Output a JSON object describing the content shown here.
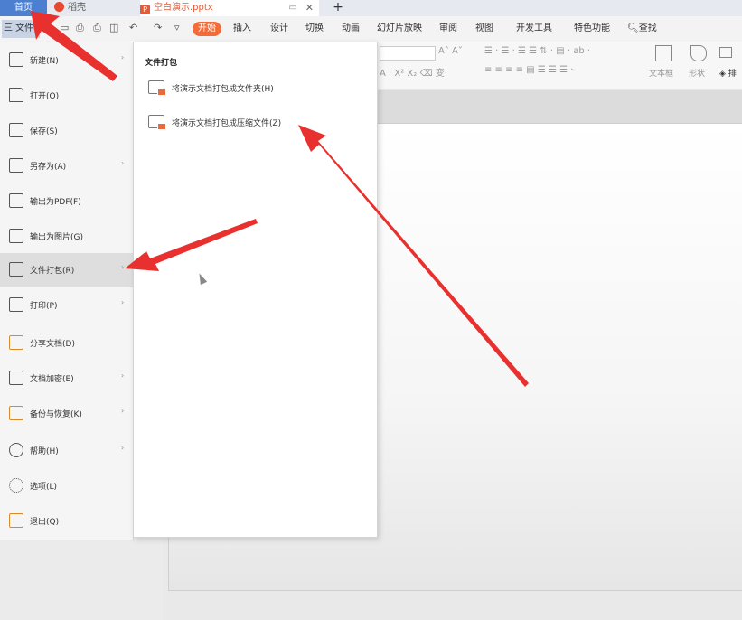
{
  "tabs": {
    "home": "首页",
    "docer": "稻壳",
    "file": "空白演示.pptx"
  },
  "menubar": {
    "file_button": "三 文件",
    "ribbon_tabs": [
      "开始",
      "插入",
      "设计",
      "切换",
      "动画",
      "幻灯片放映",
      "审阅",
      "视图",
      "开发工具",
      "特色功能"
    ],
    "active_tab": "开始",
    "search": "查找"
  },
  "ribbon": {
    "textbox": "文本框",
    "shape": "形状",
    "arrange": "排"
  },
  "file_menu": {
    "items": [
      {
        "label": "新建(N)",
        "icon": "new-file-icon",
        "has_submenu": true
      },
      {
        "label": "打开(O)",
        "icon": "folder-open-icon",
        "has_submenu": false
      },
      {
        "label": "保存(S)",
        "icon": "save-icon",
        "has_submenu": false
      },
      {
        "label": "另存为(A)",
        "icon": "save-as-icon",
        "has_submenu": true
      },
      {
        "label": "输出为PDF(F)",
        "icon": "pdf-export-icon",
        "has_submenu": false
      },
      {
        "label": "输出为图片(G)",
        "icon": "image-export-icon",
        "has_submenu": false
      },
      {
        "label": "文件打包(R)",
        "icon": "package-icon",
        "has_submenu": true,
        "selected": true
      },
      {
        "label": "打印(P)",
        "icon": "print-icon",
        "has_submenu": true
      },
      {
        "label": "分享文档(D)",
        "icon": "share-icon",
        "has_submenu": false
      },
      {
        "label": "文档加密(E)",
        "icon": "lock-document-icon",
        "has_submenu": true
      },
      {
        "label": "备份与恢复(K)",
        "icon": "backup-icon",
        "has_submenu": true
      },
      {
        "label": "帮助(H)",
        "icon": "help-icon",
        "has_submenu": true
      },
      {
        "label": "选项(L)",
        "icon": "gear-icon",
        "has_submenu": false
      },
      {
        "label": "退出(Q)",
        "icon": "exit-icon",
        "has_submenu": false
      }
    ]
  },
  "submenu": {
    "title": "文件打包",
    "items": [
      {
        "label": "将演示文档打包成文件夹(H)",
        "icon": "package-folder-icon"
      },
      {
        "label": "将演示文档打包成压缩文件(Z)",
        "icon": "package-zip-icon"
      }
    ]
  },
  "colors": {
    "accent": "#f26b38",
    "arrow": "#e8312f",
    "tab_active": "#4c7fd0"
  }
}
